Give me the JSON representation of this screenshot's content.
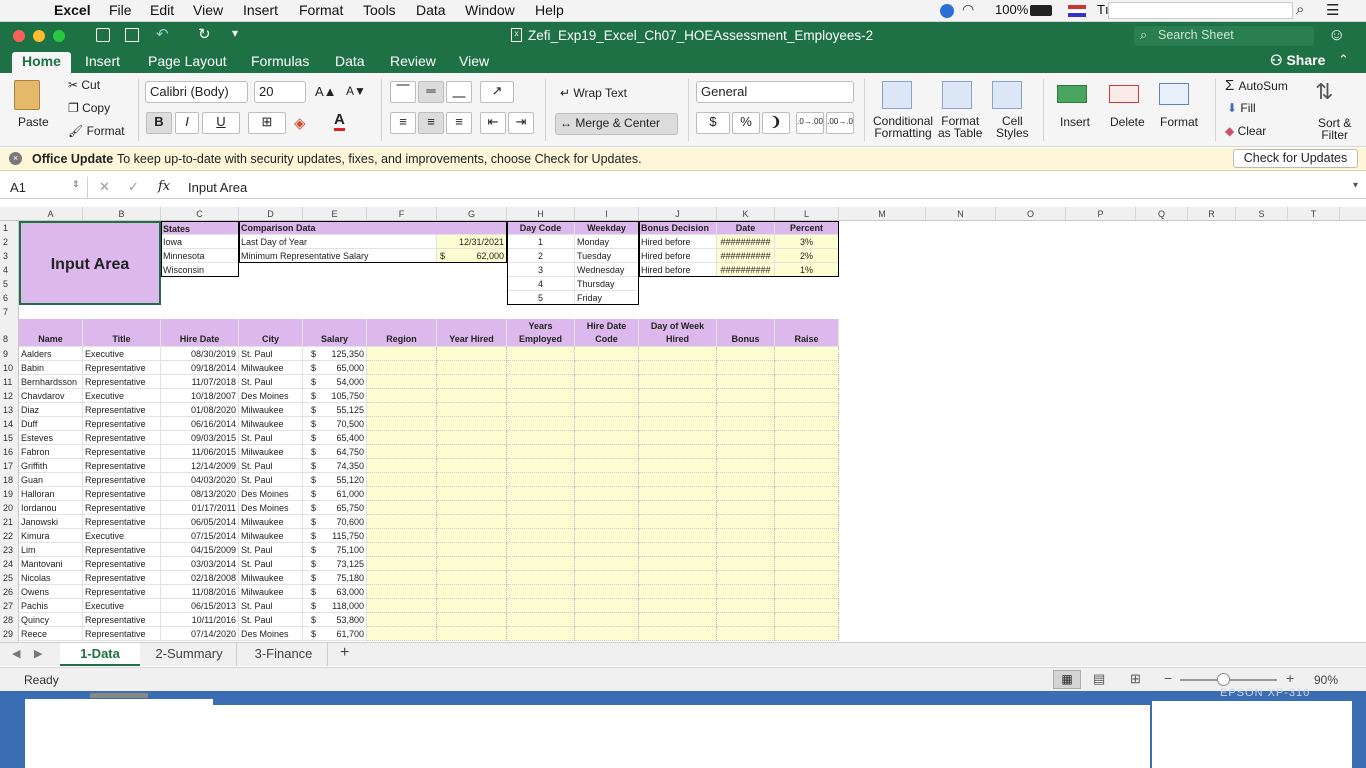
{
  "menubar": {
    "app": "Excel",
    "items": [
      "File",
      "Edit",
      "View",
      "Insert",
      "Format",
      "Tools",
      "Data",
      "Window",
      "Help"
    ],
    "battery": "100%",
    "input_abbr": "Tı"
  },
  "window": {
    "title": "Zefi_Exp19_Excel_Ch07_HOEAssessment_Employees-2",
    "search_placeholder": "Search Sheet"
  },
  "tabs": [
    "Home",
    "Insert",
    "Page Layout",
    "Formulas",
    "Data",
    "Review",
    "View"
  ],
  "share": "Share",
  "ribbon": {
    "paste": "Paste",
    "cut": "Cut",
    "copy": "Copy",
    "format": "Format",
    "font": "Calibri (Body)",
    "size": "20",
    "bold": "B",
    "italic": "I",
    "underline": "U",
    "grow": "A▲",
    "shrink": "A▼",
    "wrap": "Wrap Text",
    "merge": "Merge & Center",
    "number_format": "General",
    "currency": "$",
    "percent": "%",
    "comma": "❩",
    "inc_dec": ".0→.00",
    "dec_dec": ".00→.0",
    "cond": "Conditional",
    "cond2": "Formatting",
    "fmt_table": "Format",
    "fmt_table2": "as Table",
    "cell_styles": "Cell",
    "cell_styles2": "Styles",
    "insert": "Insert",
    "delete": "Delete",
    "format_cells": "Format",
    "autosum": "AutoSum",
    "fill": "Fill",
    "clear": "Clear",
    "sort": "Sort &",
    "sort2": "Filter"
  },
  "update_bar": {
    "title": "Office Update",
    "message": "To keep up-to-date with security updates, fixes, and improvements, choose Check for Updates.",
    "button": "Check for Updates"
  },
  "formula_bar": {
    "namebox": "A1",
    "fx": "fx",
    "content": "Input Area"
  },
  "columns": [
    "A",
    "B",
    "C",
    "D",
    "E",
    "F",
    "G",
    "H",
    "I",
    "J",
    "K",
    "L",
    "M",
    "N",
    "O",
    "P",
    "Q",
    "R",
    "S",
    "T",
    "U"
  ],
  "rows": [
    "1",
    "2",
    "3",
    "4",
    "5",
    "6",
    "7",
    "8",
    "9",
    "10",
    "11",
    "12",
    "13",
    "14",
    "15",
    "16",
    "17",
    "18",
    "19",
    "20",
    "21",
    "22",
    "23",
    "24",
    "25",
    "26",
    "27",
    "28",
    "29"
  ],
  "input_area": "Input Area",
  "states": {
    "header": "States",
    "items": [
      "Iowa",
      "Minnesota",
      "Wisconsin"
    ]
  },
  "comparison": {
    "header": "Comparison Data",
    "row1_label": "Last Day of Year",
    "row1_value": "12/31/2021",
    "row2_label": "Minimum Representative Salary",
    "row2_currency": "$",
    "row2_value": "62,000"
  },
  "daycode": {
    "header1": "Day Code",
    "header2": "Weekday",
    "codes": [
      "1",
      "2",
      "3",
      "4",
      "5"
    ],
    "days": [
      "Monday",
      "Tuesday",
      "Wednesday",
      "Thursday",
      "Friday"
    ]
  },
  "bonus": {
    "h1": "Bonus Decision",
    "h2": "Date",
    "h3": "Percent",
    "rows": [
      [
        "Hired before",
        "##########",
        "3%"
      ],
      [
        "Hired before",
        "##########",
        "2%"
      ],
      [
        "Hired before",
        "##########",
        "1%"
      ]
    ]
  },
  "table_headers": {
    "name": "Name",
    "title": "Title",
    "hire": "Hire Date",
    "city": "City",
    "salary": "Salary",
    "region": "Region",
    "year_hired": "Year Hired",
    "years1": "Years",
    "years2": "Employed",
    "hdc1": "Hire Date",
    "hdc2": "Code",
    "dow1": "Day of Week",
    "dow2": "Hired",
    "bonus": "Bonus",
    "raise": "Raise"
  },
  "employees": [
    [
      "Aalders",
      "Executive",
      "08/30/2019",
      "St. Paul",
      "125,350"
    ],
    [
      "Babin",
      "Representative",
      "09/18/2014",
      "Milwaukee",
      "65,000"
    ],
    [
      "Bernhardsson",
      "Representative",
      "11/07/2018",
      "St. Paul",
      "54,000"
    ],
    [
      "Chavdarov",
      "Executive",
      "10/18/2007",
      "Des Moines",
      "105,750"
    ],
    [
      "Diaz",
      "Representative",
      "01/08/2020",
      "Milwaukee",
      "55,125"
    ],
    [
      "Duff",
      "Representative",
      "06/16/2014",
      "Milwaukee",
      "70,500"
    ],
    [
      "Esteves",
      "Representative",
      "09/03/2015",
      "St. Paul",
      "65,400"
    ],
    [
      "Fabron",
      "Representative",
      "11/06/2015",
      "Milwaukee",
      "64,750"
    ],
    [
      "Griffith",
      "Representative",
      "12/14/2009",
      "St. Paul",
      "74,350"
    ],
    [
      "Guan",
      "Representative",
      "04/03/2020",
      "St. Paul",
      "55,120"
    ],
    [
      "Halloran",
      "Representative",
      "08/13/2020",
      "Des Moines",
      "61,000"
    ],
    [
      "Iordanou",
      "Representative",
      "01/17/2011",
      "Des Moines",
      "65,750"
    ],
    [
      "Janowski",
      "Representative",
      "06/05/2014",
      "Milwaukee",
      "70,600"
    ],
    [
      "Kimura",
      "Executive",
      "07/15/2014",
      "Milwaukee",
      "115,750"
    ],
    [
      "Lim",
      "Representative",
      "04/15/2009",
      "St. Paul",
      "75,100"
    ],
    [
      "Mantovani",
      "Representative",
      "03/03/2014",
      "St. Paul",
      "73,125"
    ],
    [
      "Nicolas",
      "Representative",
      "02/18/2008",
      "Milwaukee",
      "75,180"
    ],
    [
      "Owens",
      "Representative",
      "11/08/2016",
      "Milwaukee",
      "63,000"
    ],
    [
      "Pachis",
      "Executive",
      "06/15/2013",
      "St. Paul",
      "118,000"
    ],
    [
      "Quincy",
      "Representative",
      "10/11/2016",
      "St. Paul",
      "53,800"
    ],
    [
      "Reece",
      "Representative",
      "07/14/2020",
      "Des Moines",
      "61,700"
    ]
  ],
  "currency_symbol": "$",
  "sheets": [
    "1-Data",
    "2-Summary",
    "3-Finance"
  ],
  "add_sheet": "+",
  "status": {
    "ready": "Ready",
    "zoom": "90%"
  },
  "printer": "EPSON XP-310",
  "colors": {
    "excel_green": "#1e7145",
    "purple": "#dcb8ec",
    "yellow": "#fdfdd2"
  }
}
